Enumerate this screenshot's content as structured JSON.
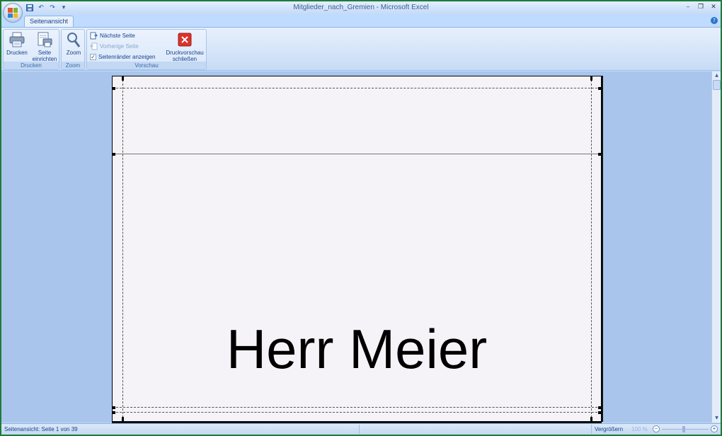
{
  "window": {
    "title": "Mitglieder_nach_Gremien - Microsoft Excel",
    "controls": {
      "minimize": "–",
      "restore": "❐",
      "close": "✕"
    }
  },
  "qat": {
    "save_icon": "save-icon",
    "undo": "↶",
    "redo": "↷",
    "customize": "▾"
  },
  "tabs": [
    {
      "label": "Seitenansicht",
      "active": true
    }
  ],
  "help": "?",
  "ribbon": {
    "groups": {
      "drucken": {
        "label": "Drucken",
        "print_label": "Drucken",
        "setup_label_1": "Seite",
        "setup_label_2": "einrichten"
      },
      "zoom": {
        "label": "Zoom",
        "zoom_label": "Zoom"
      },
      "vorschau": {
        "label": "Vorschau",
        "next_page": "Nächste Seite",
        "prev_page": "Vorherige Seite",
        "show_margins": "Seitenränder anzeigen",
        "show_margins_checked": true,
        "close_label_1": "Druckvorschau",
        "close_label_2": "schließen"
      }
    }
  },
  "preview": {
    "page_text": "Herr Meier"
  },
  "statusbar": {
    "text": "Seitenansicht: Seite 1 von 39",
    "zoom_label": "Vergrößern",
    "zoom_percent": "100 %",
    "zoom_minus": "−",
    "zoom_plus": "+"
  },
  "colors": {
    "ribbon_text": "#15428b",
    "preview_background": "#a9c5ec",
    "close_button_red": "#d9342b"
  }
}
